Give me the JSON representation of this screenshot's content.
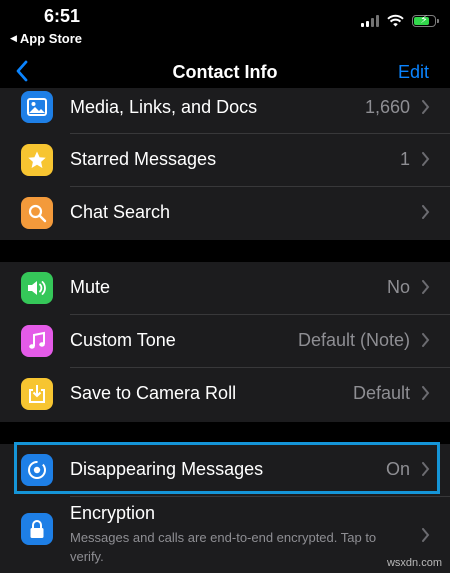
{
  "status_bar": {
    "time": "6:51",
    "back_app": "App Store",
    "battery_color": "#32d74b"
  },
  "nav": {
    "title": "Contact Info",
    "edit_label": "Edit",
    "accent_color": "#0a84ff"
  },
  "group1": [
    {
      "icon": "photo-icon",
      "icon_color": "#1e7fe6",
      "label": "Media, Links, and Docs",
      "value": "1,660"
    },
    {
      "icon": "star-icon",
      "icon_color": "#f7c531",
      "label": "Starred Messages",
      "value": "1"
    },
    {
      "icon": "search-icon",
      "icon_color": "#f39a3b",
      "label": "Chat Search",
      "value": ""
    }
  ],
  "group2": [
    {
      "icon": "speaker-icon",
      "icon_color": "#35c759",
      "label": "Mute",
      "value": "No"
    },
    {
      "icon": "music-note-icon",
      "icon_color": "#e45be8",
      "label": "Custom Tone",
      "value": "Default (Note)"
    },
    {
      "icon": "save-download-icon",
      "icon_color": "#f7c531",
      "label": "Save to Camera Roll",
      "value": "Default"
    }
  ],
  "group3": [
    {
      "icon": "timer-icon",
      "icon_color": "#1e7fe6",
      "label": "Disappearing Messages",
      "value": "On"
    },
    {
      "icon": "lock-icon",
      "icon_color": "#1e7fe6",
      "label": "Encryption",
      "sublabel": "Messages and calls are end-to-end encrypted. Tap to verify."
    }
  ],
  "watermark": "wsxdn.com"
}
